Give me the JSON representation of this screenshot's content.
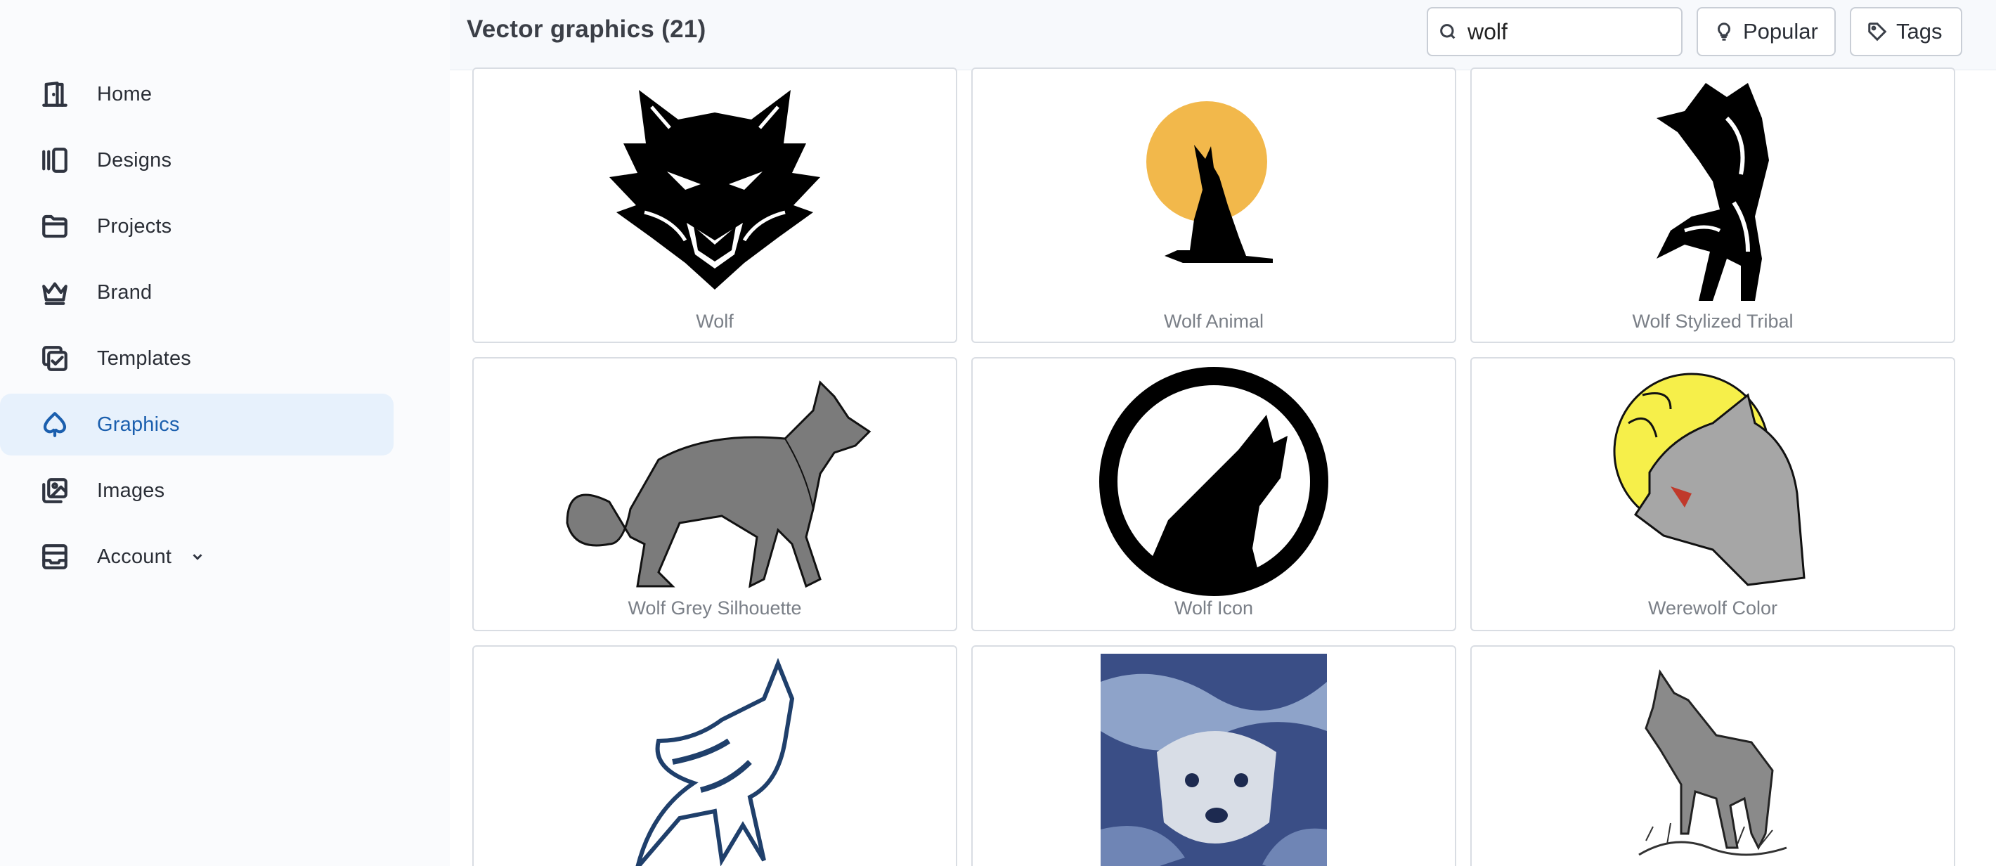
{
  "sidebar": {
    "items": [
      {
        "label": "Home",
        "icon": "door-icon"
      },
      {
        "label": "Designs",
        "icon": "columns-icon"
      },
      {
        "label": "Projects",
        "icon": "folder-icon"
      },
      {
        "label": "Brand",
        "icon": "crown-icon"
      },
      {
        "label": "Templates",
        "icon": "copy-check-icon"
      },
      {
        "label": "Graphics",
        "icon": "cloud-shape-icon",
        "active": true
      },
      {
        "label": "Images",
        "icon": "images-icon"
      },
      {
        "label": "Account",
        "icon": "archive-icon"
      }
    ]
  },
  "header": {
    "title": "Vector graphics (21)",
    "search_value": "wolf",
    "popular_label": "Popular",
    "tags_label": "Tags"
  },
  "graphics": [
    {
      "caption": "Wolf"
    },
    {
      "caption": "Wolf Animal"
    },
    {
      "caption": "Wolf Stylized Tribal"
    },
    {
      "caption": "Wolf Grey Silhouette"
    },
    {
      "caption": "Wolf Icon"
    },
    {
      "caption": "Werewolf Color"
    },
    {
      "caption": ""
    },
    {
      "caption": ""
    },
    {
      "caption": ""
    }
  ],
  "colors": {
    "accent": "#1b5fae",
    "active_bg": "#e7f1fc",
    "sun": "#f2b84b",
    "moon": "#f6ef4a",
    "wolf_grey": "#7b7b7b"
  }
}
